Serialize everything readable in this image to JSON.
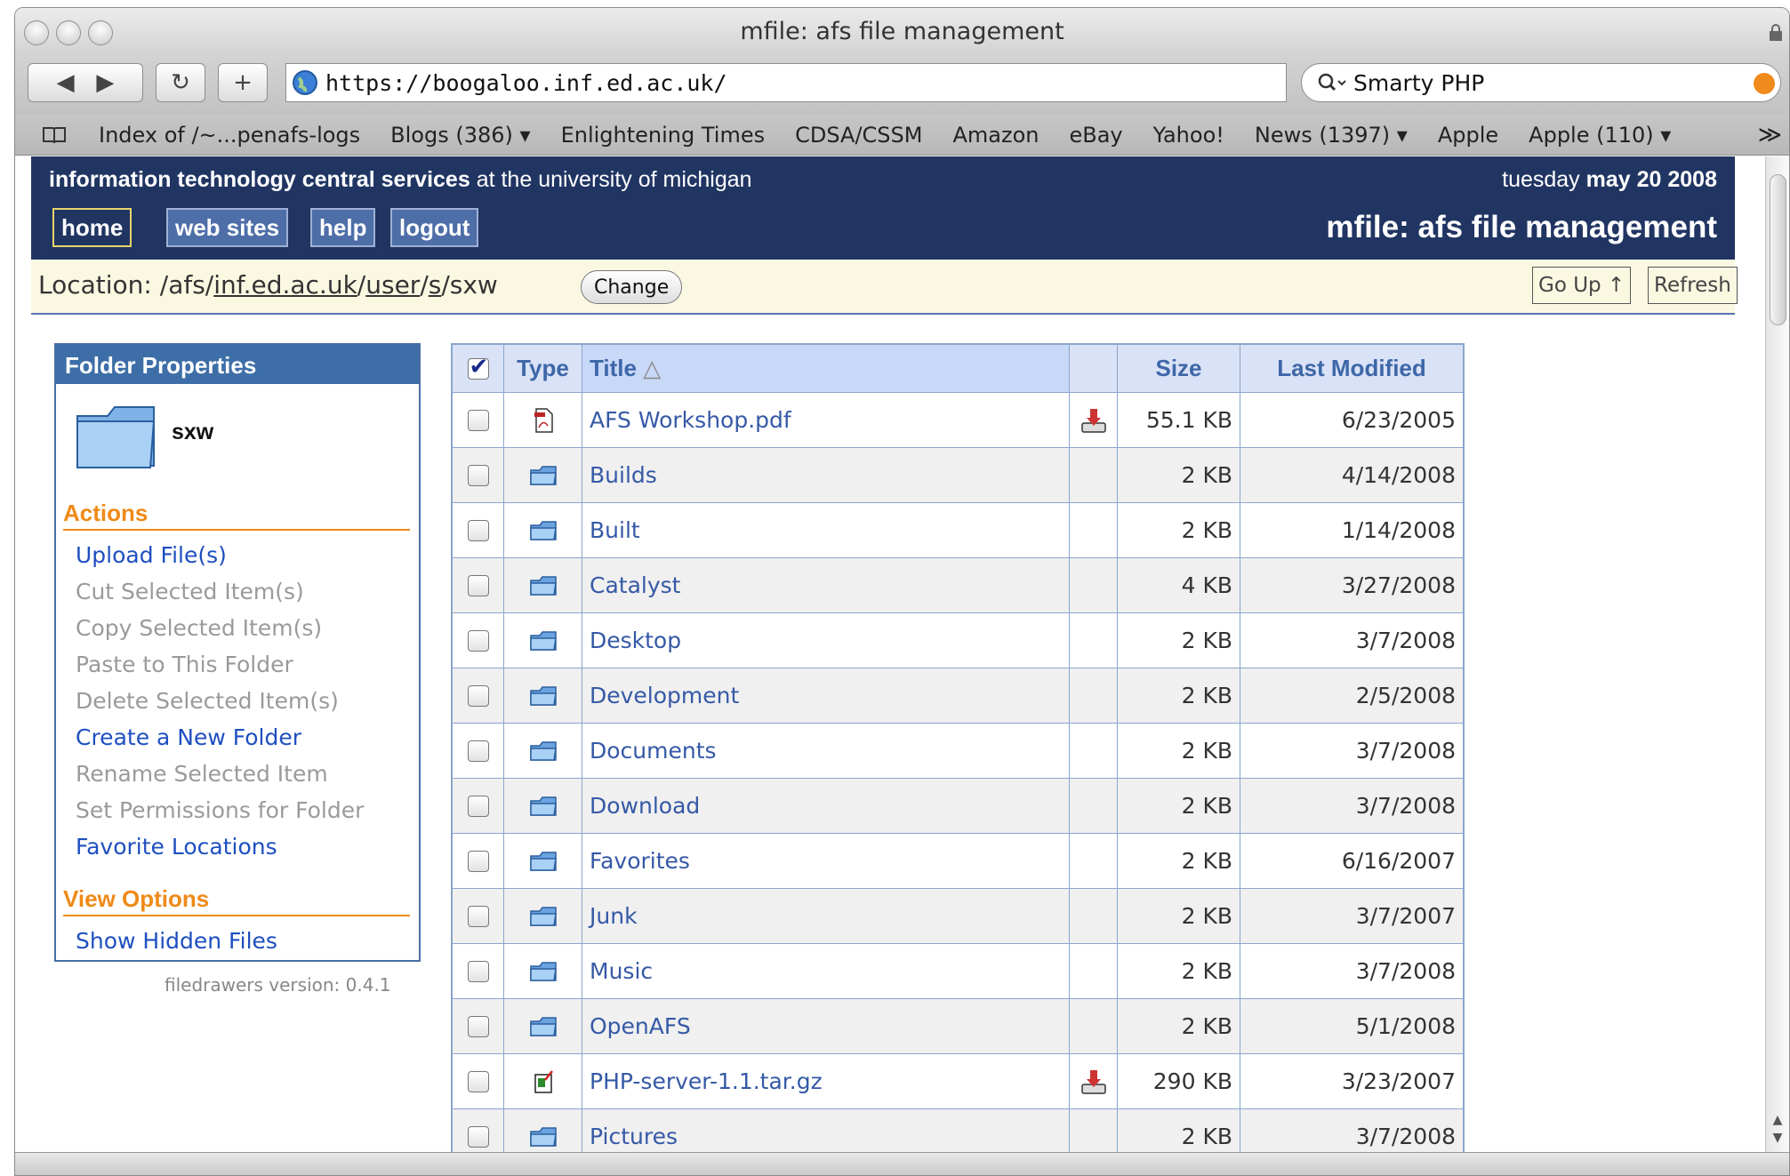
{
  "window": {
    "title": "mfile: afs file management",
    "url": "https://boogaloo.inf.ed.ac.uk/",
    "search_value": "Smarty PHP",
    "bookmarks": [
      "Index of /~...penafs-logs",
      "Blogs (386) ▾",
      "Enlightening Times",
      "CDSA/CSSM",
      "Amazon",
      "eBay",
      "Yahoo!",
      "News (1397) ▾",
      "Apple",
      "Apple (110) ▾"
    ],
    "overflow_glyph": "≫"
  },
  "header": {
    "org_bold": "information technology central services",
    "org_rest": " at the university of michigan",
    "date_day": "tuesday ",
    "date_bold": "may 20 2008",
    "app_title": "mfile: afs file management",
    "nav": [
      "home",
      "web sites",
      "help",
      "logout"
    ]
  },
  "location": {
    "label": "Location:",
    "prefix": " /afs/",
    "seg1": "inf.ed.ac.uk",
    "sep1": "/",
    "seg2": "user",
    "sep2": "/",
    "seg3": "s",
    "tail": "/sxw",
    "change_label": "Change",
    "go_up_label": "Go Up ↑",
    "refresh_label": "Refresh"
  },
  "sidebar": {
    "title": "Folder Properties",
    "folder_name": "sxw",
    "actions_title": "Actions",
    "actions": [
      {
        "label": "Upload File(s)",
        "enabled": true
      },
      {
        "label": "Cut Selected Item(s)",
        "enabled": false
      },
      {
        "label": "Copy Selected Item(s)",
        "enabled": false
      },
      {
        "label": "Paste to This Folder",
        "enabled": false
      },
      {
        "label": "Delete Selected Item(s)",
        "enabled": false
      },
      {
        "label": "Create a New Folder",
        "enabled": true
      },
      {
        "label": "Rename Selected Item",
        "enabled": false
      },
      {
        "label": "Set Permissions for Folder",
        "enabled": false
      },
      {
        "label": "Favorite Locations",
        "enabled": true
      }
    ],
    "view_title": "View Options",
    "view_options": [
      "Show Hidden Files"
    ],
    "version": "filedrawers version: 0.4.1"
  },
  "table": {
    "headers": {
      "type": "Type",
      "title": "Title",
      "sort_glyph": "△",
      "size": "Size",
      "modified": "Last Modified"
    },
    "rows": [
      {
        "type": "pdf",
        "name": "AFS Workshop.pdf",
        "download": true,
        "size": "55.1 KB",
        "modified": "6/23/2005"
      },
      {
        "type": "folder",
        "name": "Builds",
        "download": false,
        "size": "2 KB",
        "modified": "4/14/2008"
      },
      {
        "type": "folder",
        "name": "Built",
        "download": false,
        "size": "2 KB",
        "modified": "1/14/2008"
      },
      {
        "type": "folder",
        "name": "Catalyst",
        "download": false,
        "size": "4 KB",
        "modified": "3/27/2008"
      },
      {
        "type": "folder",
        "name": "Desktop",
        "download": false,
        "size": "2 KB",
        "modified": "3/7/2008"
      },
      {
        "type": "folder",
        "name": "Development",
        "download": false,
        "size": "2 KB",
        "modified": "2/5/2008"
      },
      {
        "type": "folder",
        "name": "Documents",
        "download": false,
        "size": "2 KB",
        "modified": "3/7/2008"
      },
      {
        "type": "folder",
        "name": "Download",
        "download": false,
        "size": "2 KB",
        "modified": "3/7/2008"
      },
      {
        "type": "folder",
        "name": "Favorites",
        "download": false,
        "size": "2 KB",
        "modified": "6/16/2007"
      },
      {
        "type": "folder",
        "name": "Junk",
        "download": false,
        "size": "2 KB",
        "modified": "3/7/2007"
      },
      {
        "type": "folder",
        "name": "Music",
        "download": false,
        "size": "2 KB",
        "modified": "3/7/2008"
      },
      {
        "type": "folder",
        "name": "OpenAFS",
        "download": false,
        "size": "2 KB",
        "modified": "5/1/2008"
      },
      {
        "type": "archive",
        "name": "PHP-server-1.1.tar.gz",
        "download": true,
        "size": "290 KB",
        "modified": "3/23/2007"
      },
      {
        "type": "folder",
        "name": "Pictures",
        "download": false,
        "size": "2 KB",
        "modified": "3/7/2008"
      }
    ]
  },
  "colors": {
    "header_bg": "#213563",
    "accent_orange": "#ef8a18",
    "link_blue": "#3559a6"
  }
}
